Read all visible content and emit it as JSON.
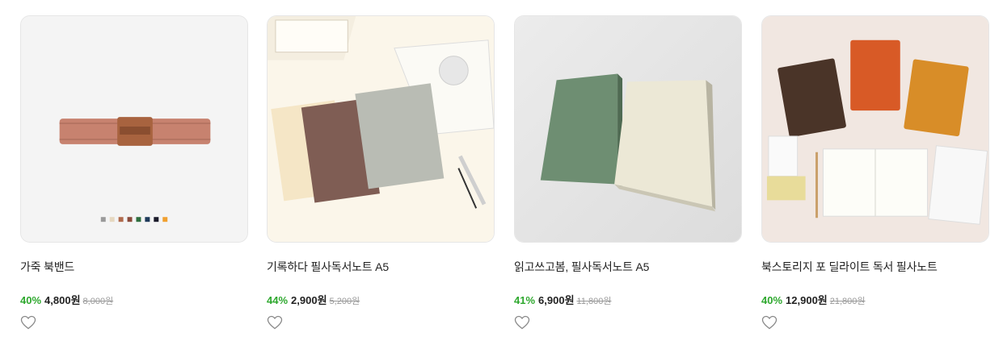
{
  "products": [
    {
      "title": "가죽 북밴드",
      "discount": "40%",
      "price": "4,800원",
      "original_price": "8,000원",
      "swatch_colors": [
        "#9a9a9a",
        "#e6d8c0",
        "#b06a4c",
        "#8a4a3a",
        "#2e6e3e",
        "#1e3a5a",
        "#1a1a2a",
        "#f0a030"
      ]
    },
    {
      "title": "기록하다 필사독서노트 A5",
      "discount": "44%",
      "price": "2,900원",
      "original_price": "5,200원"
    },
    {
      "title": "읽고쓰고봄, 필사독서노트 A5",
      "discount": "41%",
      "price": "6,900원",
      "original_price": "11,800원"
    },
    {
      "title": "북스토리지 포 딜라이트 독서 필사노트",
      "discount": "40%",
      "price": "12,900원",
      "original_price": "21,800원"
    }
  ],
  "colors": {
    "discount": "#2ea82e",
    "text": "#222222",
    "strike": "#999999"
  },
  "icons": {
    "wishlist": "heart-outline-icon"
  }
}
